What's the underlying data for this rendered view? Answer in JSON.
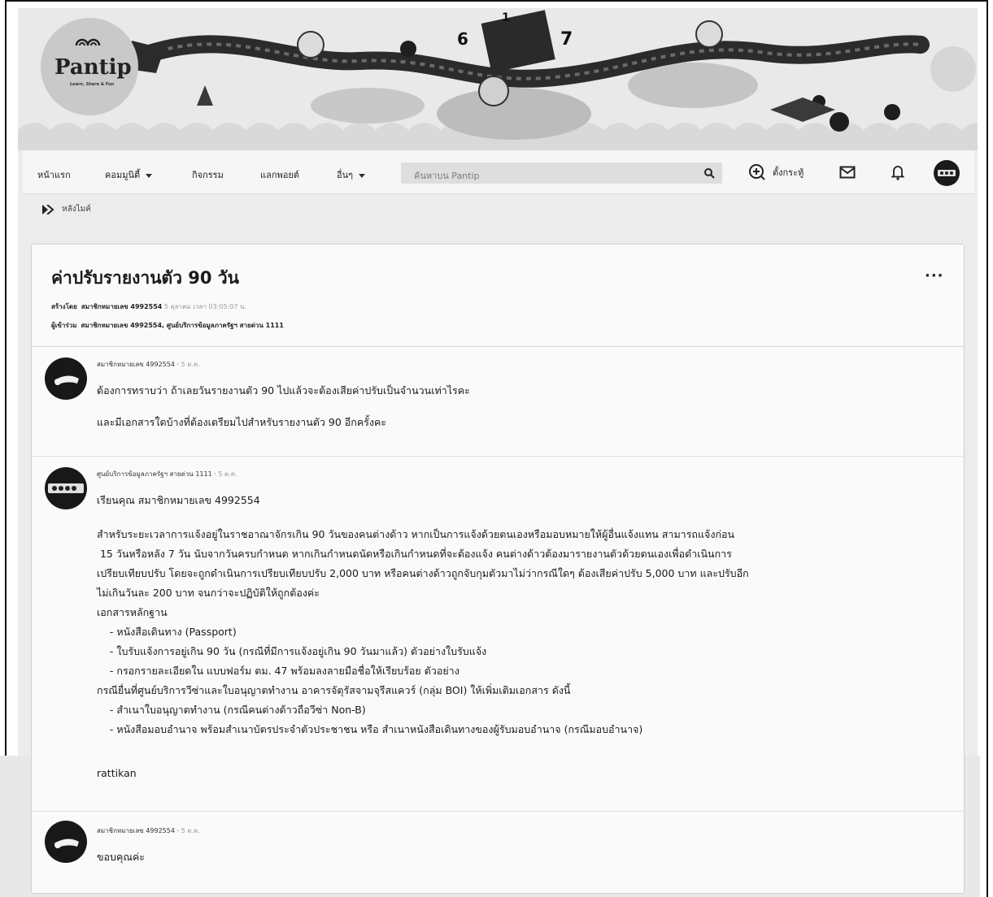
{
  "logo": {
    "word": "Pantip",
    "tagline": "Learn, Share & Fun"
  },
  "banner": {
    "numbers": [
      "6",
      "1",
      "7"
    ]
  },
  "nav": {
    "home": "หน้าแรก",
    "community": "คอมมูนิตี้",
    "activities": "กิจกรรม",
    "pantip_point": "แลกพอยต์",
    "more": "อื่นๆ",
    "search_placeholder": "ค้นหาบน Pantip",
    "post_topic": "ตั้งกระทู้"
  },
  "breadcrumb": {
    "label": "หลังไมค์"
  },
  "topic": {
    "title": "ค่าปรับรายงานตัว 90 วัน",
    "created_by_label": "สร้างโดย",
    "created_by": "สมาชิกหมายเลข 4992554",
    "created_date": "5 ตุลาคม เวลา 03:05:07 น.",
    "participants_label": "ผู้เข้าร่วม",
    "participants": "สมาชิกหมายเลข 4992554, ศูนย์บริการข้อมูลภาครัฐฯ สายด่วน 1111",
    "more_label": "···"
  },
  "posts": [
    {
      "user": "สมาชิกหมายเลข 4992554",
      "time": "5 ต.ค.",
      "lines": [
        "ต้องการทราบว่า ถ้าเลยวันรายงานตัว 90 ไปแล้วจะต้องเสียค่าปรับเป็นจำนวนเท่าไรคะ",
        "และมีเอกสารใดบ้างที่ต้องเตรียมไปสำหรับรายงานตัว 90 อีกครั้งคะ"
      ]
    },
    {
      "user": "ศูนย์บริการข้อมูลภาครัฐฯ สายด่วน 1111",
      "time": "5 ต.ค.",
      "greeting": "เรียนคุณ สมาชิกหมายเลข 4992554",
      "lines": [
        "สำหรับระยะเวลาการแจ้งอยู่ในราชอาณาจักรเกิน 90 วันของคนต่างด้าว หากเป็นการแจ้งด้วยตนเองหรือมอบหมายให้ผู้อื่นแจ้งแทน สามารถแจ้งก่อน",
        " 15 วันหรือหลัง 7 วัน นับจากวันครบกำหนด หากเกินกำหนดนัดหรือเกินกำหนดที่จะต้องแจ้ง คนต่างด้าวต้องมารายงานตัวด้วยตนเองเพื่อดำเนินการ",
        "เปรียบเทียบปรับ โดยจะถูกดำเนินการเปรียบเทียบปรับ 2,000 บาท หรือคนต่างด้าวถูกจับกุมตัวมาไม่ว่ากรณีใดๆ ต้องเสียค่าปรับ 5,000 บาท และปรับอีก",
        "ไม่เกินวันละ 200 บาท จนกว่าจะปฏิบัติให้ถูกต้องค่ะ",
        "เอกสารหลักฐาน",
        "    - หนังสือเดินทาง (Passport)",
        "    - ใบรับแจ้งการอยู่เกิน 90 วัน (กรณีที่มีการแจ้งอยู่เกิน 90 วันมาแล้ว) ตัวอย่างใบรับแจ้ง",
        "    - กรอกรายละเอียดใน แบบฟอร์ม ตม. 47 พร้อมลงลายมือชื่อให้เรียบร้อย ตัวอย่าง",
        "กรณียื่นที่ศูนย์บริการวีซ่าและใบอนุญาตทำงาน อาคารจัตุรัสจามจุรีสแควร์ (กลุ่ม BOI) ให้เพิ่มเติมเอกสาร ดังนี้",
        "    - สำเนาใบอนุญาตทำงาน (กรณีคนต่างด้าวถือวีซ่า Non-B)",
        "    - หนังสือมอบอำนาจ พร้อมสำเนาบัตรประจำตัวประชาชน หรือ สำเนาหนังสือเดินทางของผู้รับมอบอำนาจ (กรณีมอบอำนาจ)"
      ],
      "signature": "rattikan"
    },
    {
      "user": "สมาชิกหมายเลข 4992554",
      "time": "5 ต.ค.",
      "lines": [
        "ขอบคุณค่ะ"
      ]
    }
  ]
}
